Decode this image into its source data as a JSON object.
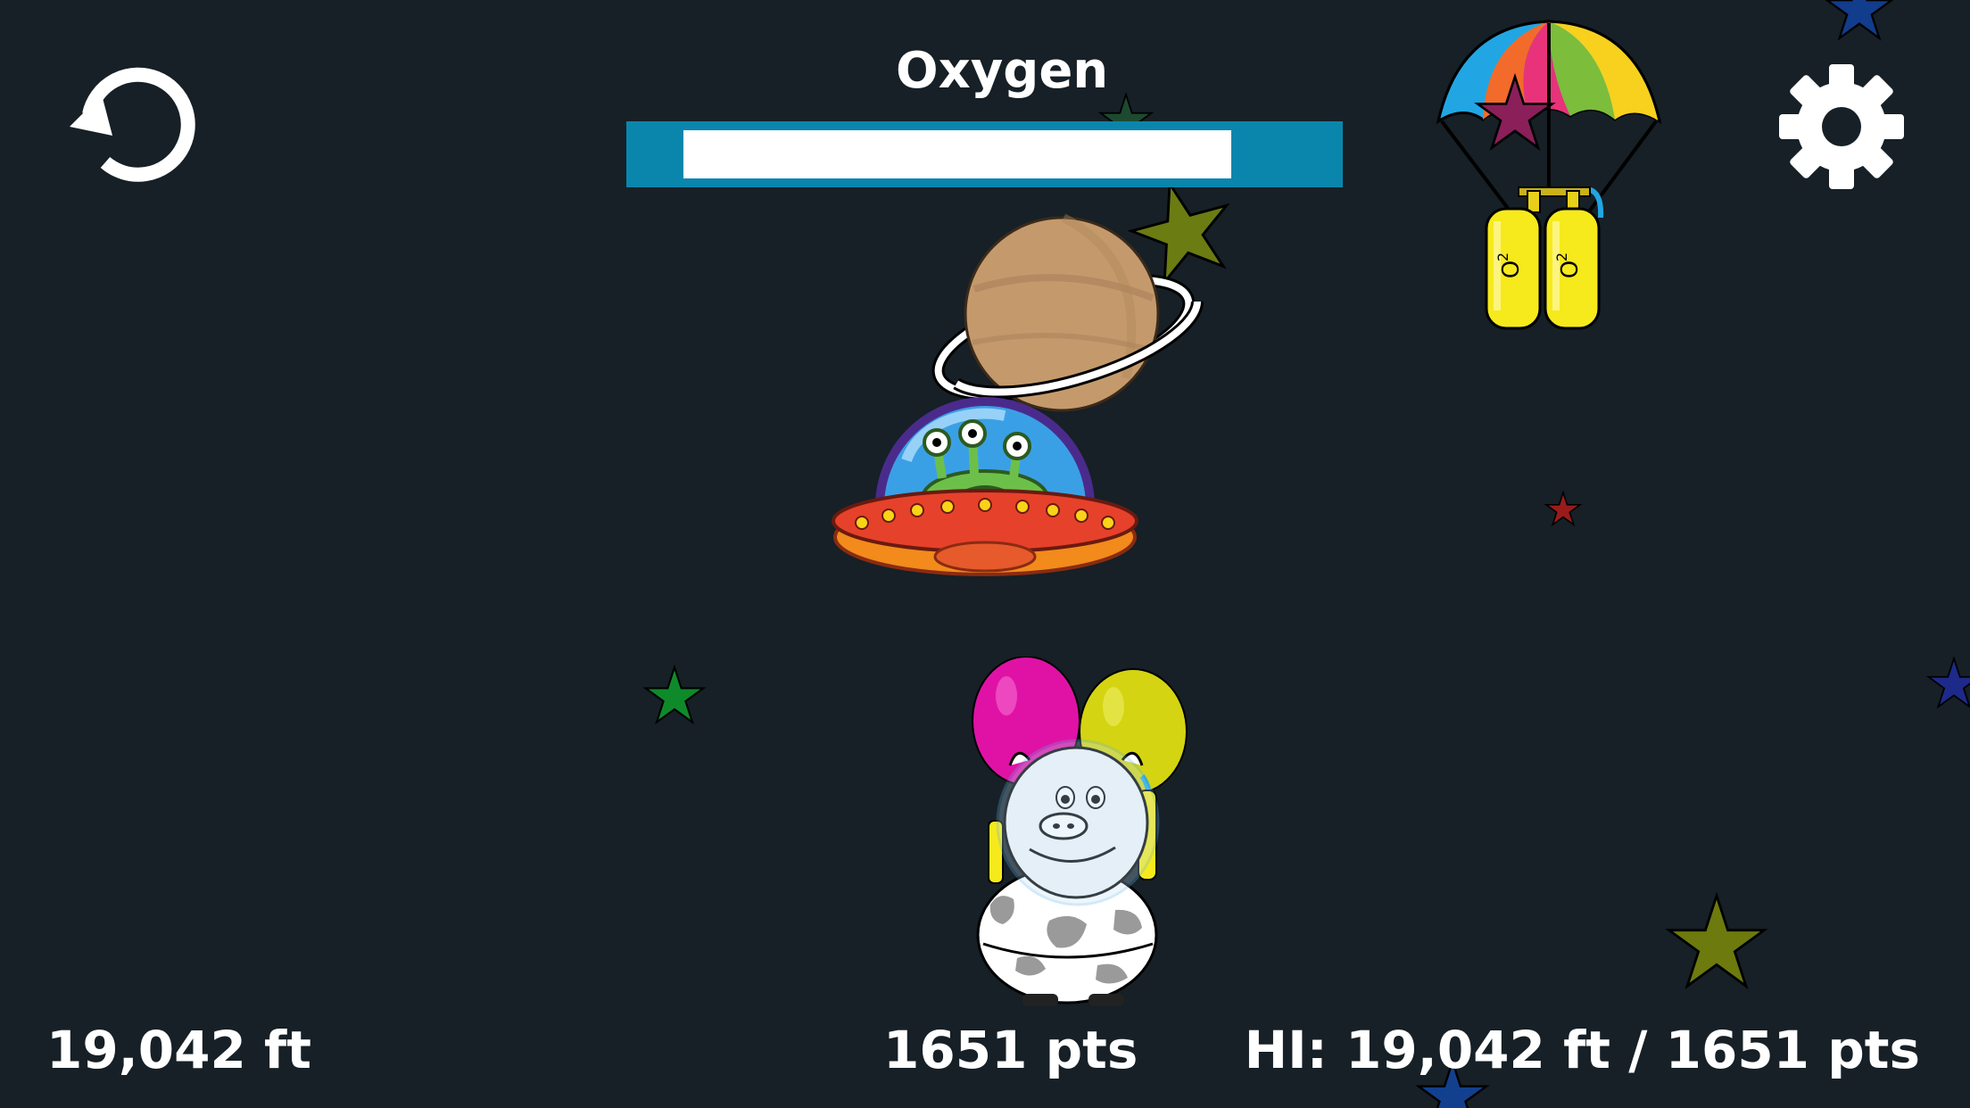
{
  "hud": {
    "oxygen_label": "Oxygen",
    "oxygen_level": 0.91,
    "distance": "19,042 ft",
    "points": "1651 pts",
    "high_score": "HI: 19,042 ft / 1651 pts"
  },
  "controls": {
    "restart_icon": "restart-icon",
    "settings_icon": "gear-icon"
  },
  "oxygen_tanks": {
    "tank_label": "O",
    "tank_subscript": "2"
  },
  "colors": {
    "background": "#162026",
    "oxygen_frame": "#0a86ad",
    "oxygen_fill": "#ffffff"
  }
}
